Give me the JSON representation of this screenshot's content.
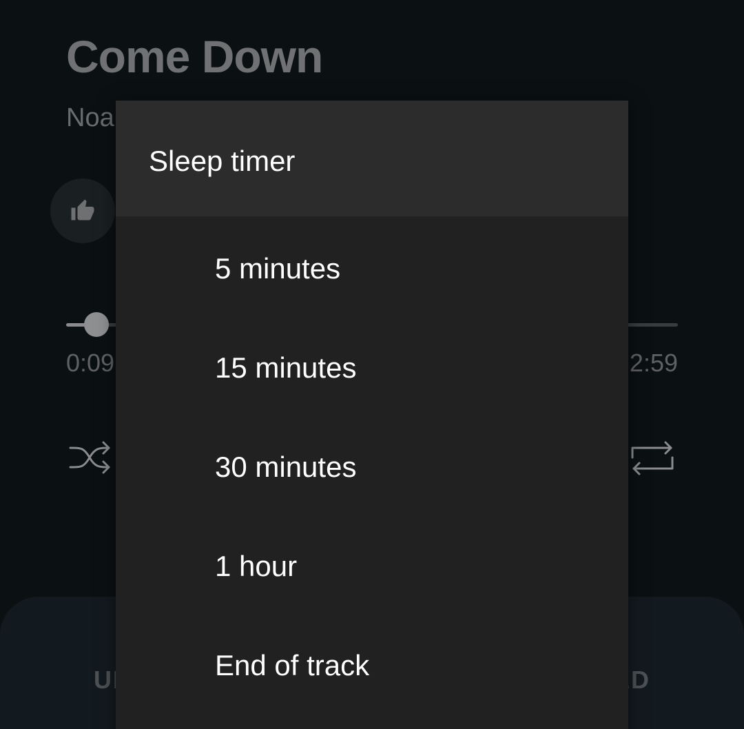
{
  "player": {
    "title": "Come Down",
    "artist": "Noa",
    "elapsed": "0:09",
    "total": "2:59",
    "progress_fraction": 0.05
  },
  "bottom_tabs": {
    "left_label": "UP NEXT",
    "right_label": "RELATED"
  },
  "sleep_timer": {
    "title": "Sleep timer",
    "options": [
      {
        "label": "5 minutes"
      },
      {
        "label": "15 minutes"
      },
      {
        "label": "30 minutes"
      },
      {
        "label": "1 hour"
      },
      {
        "label": "End of track"
      }
    ]
  },
  "colors": {
    "dialog_background": "#212121",
    "dialog_header": "#2c2c2c",
    "screen_background": "#0b1013"
  },
  "icons": {
    "like": "thumb-up-icon",
    "shuffle": "shuffle-icon",
    "repeat": "repeat-icon"
  }
}
